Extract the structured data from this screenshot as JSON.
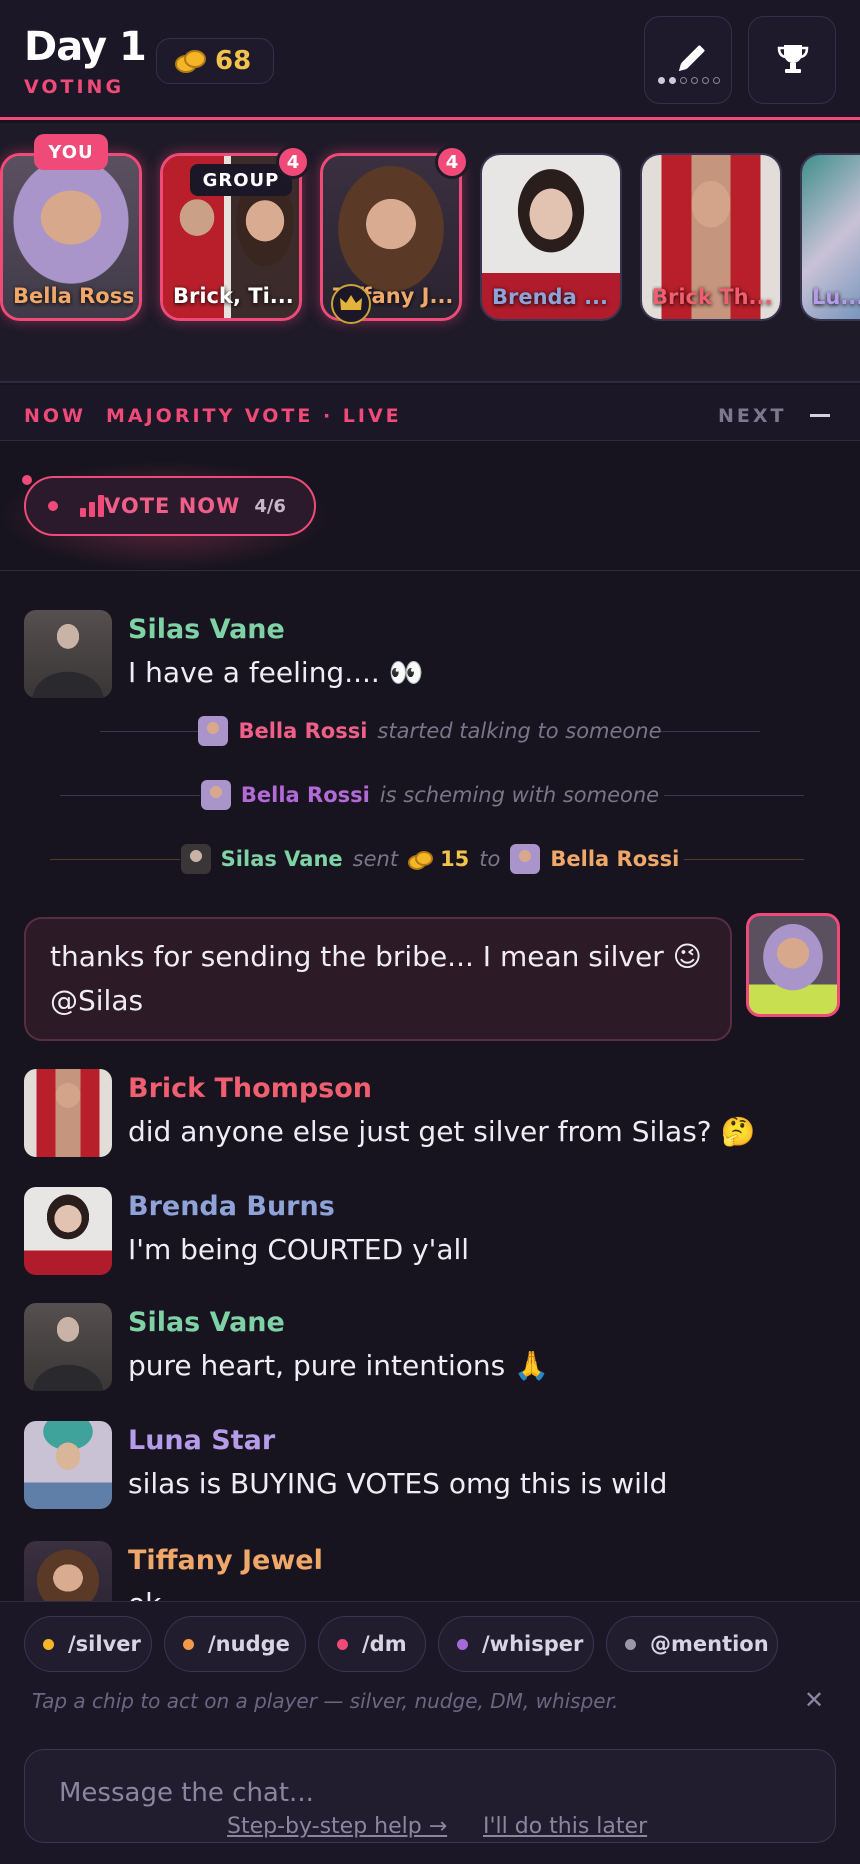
{
  "header": {
    "day_title": "Day 1",
    "phase": "VOTING",
    "silver_balance": "68"
  },
  "players": [
    {
      "name": "Bella Rossi",
      "badge": "YOU"
    },
    {
      "name": "Brick, Ti...",
      "badge": "GROUP",
      "count": "4"
    },
    {
      "name": "Tiffany J...",
      "count": "4",
      "crown": true
    },
    {
      "name": "Brenda ..."
    },
    {
      "name": "Brick Th..."
    },
    {
      "name": "Lu..."
    }
  ],
  "vote_bar": {
    "now": "NOW",
    "status": "MAJORITY VOTE · LIVE",
    "next": "NEXT"
  },
  "vote_button": {
    "label": "VOTE NOW",
    "count": "4/6"
  },
  "chat": {
    "messages": [
      {
        "author": "Silas Vane",
        "text": "I have a feeling.... 👀"
      },
      {
        "author": "Brick Thompson",
        "text": "did anyone else just get silver from Silas? 🤔"
      },
      {
        "author": "Brenda Burns",
        "text": "I'm being COURTED y'all"
      },
      {
        "author": "Silas Vane",
        "text": "pure heart, pure intentions 🙏"
      },
      {
        "author": "Luna Star",
        "text": "silas is BUYING VOTES omg this is wild"
      },
      {
        "author": "Tiffany Jewel",
        "text": "ok"
      }
    ],
    "system_events": [
      {
        "name": "Bella Rossi",
        "action": "started talking to someone"
      },
      {
        "name": "Bella Rossi",
        "action": "is scheming with someone"
      }
    ],
    "transfer": {
      "from": "Silas Vane",
      "verb": "sent",
      "amount": "15",
      "to_word": "to",
      "to": "Bella Rossi"
    },
    "own_message": {
      "line1": "thanks for sending the bribe... I mean silver 😉",
      "line2": "@Silas"
    }
  },
  "chips": [
    {
      "label": "/silver",
      "color": "#f4b626"
    },
    {
      "label": "/nudge",
      "color": "#f29a45"
    },
    {
      "label": "/dm",
      "color": "#ef4a78"
    },
    {
      "label": "/whisper",
      "color": "#a66ad8"
    },
    {
      "label": "@mention",
      "color": "#9b97a8"
    }
  ],
  "hint": "Tap a chip to act on a player — silver, nudge, DM, whisper.",
  "composer": {
    "placeholder": "Message the chat..."
  },
  "links": {
    "help": "Step-by-step help →",
    "later": "I'll do this later"
  },
  "colors": {
    "accent": "#ef4a78",
    "silver": "#f3c24b",
    "silas": "#7fd1a6",
    "bella_whisper": "#b26ad6",
    "bella_transfer": "#f0a86a",
    "brick": "#ef5f6f",
    "brenda": "#8fa3d8",
    "luna": "#b59be8",
    "tiffany": "#f0a86a"
  }
}
